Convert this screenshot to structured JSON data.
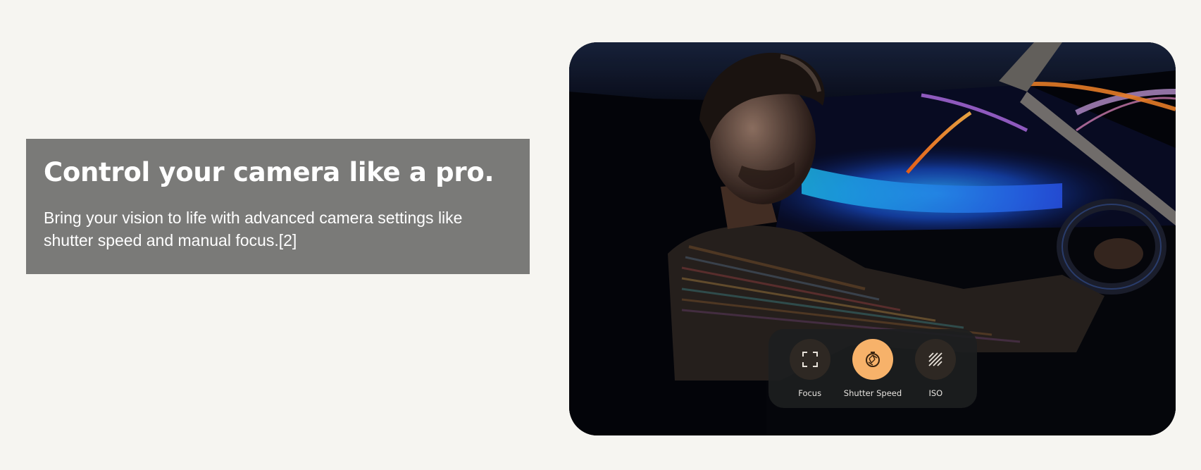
{
  "feature": {
    "title": "Control your camera like a pro.",
    "description": "Bring your vision to life with advanced camera settings like shutter speed and manual focus.[2]"
  },
  "camera_controls": [
    {
      "label": "Focus",
      "icon": "focus-frame-icon",
      "active": false
    },
    {
      "label": "Shutter Speed",
      "icon": "shutter-speed-icon",
      "active": true
    },
    {
      "label": "ISO",
      "icon": "iso-icon",
      "active": false
    }
  ],
  "colors": {
    "page_background": "#f6f5f1",
    "text_card_background": "#7a7a78",
    "active_control": "#f7b26a",
    "control_panel": "#1c1e20"
  }
}
